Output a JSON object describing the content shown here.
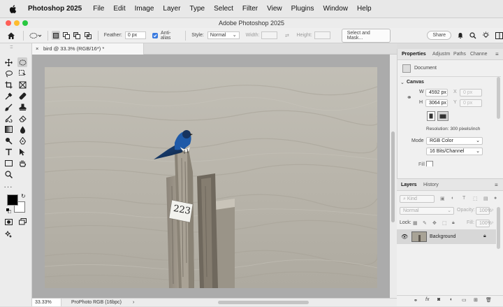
{
  "menubar": {
    "app": "Photoshop 2025",
    "items": [
      "File",
      "Edit",
      "Image",
      "Layer",
      "Type",
      "Select",
      "Filter",
      "View",
      "Plugins",
      "Window",
      "Help"
    ]
  },
  "window": {
    "title": "Adobe Photoshop 2025"
  },
  "options": {
    "feather_label": "Feather:",
    "feather_value": "0 px",
    "antialias_label": "Anti-alias",
    "style_label": "Style:",
    "style_value": "Normal",
    "width_label": "Width:",
    "height_label": "Height:",
    "select_mask": "Select and Mask...",
    "share": "Share"
  },
  "document": {
    "tab_title": "bird @ 33.3% (RGB/16*) *",
    "zoom": "33.33%",
    "profile": "ProPhoto RGB (16bpc)",
    "sign_text": "223"
  },
  "properties": {
    "tabs": [
      "Properties",
      "Adjustm",
      "Paths",
      "Channe"
    ],
    "doc_label": "Document",
    "section": "Canvas",
    "w_label": "W",
    "w_value": "4592 px",
    "h_label": "H",
    "h_value": "3064 px",
    "x_label": "X",
    "x_value": "0 px",
    "y_label": "Y",
    "y_value": "0 px",
    "resolution": "Resolution: 300 pixels/inch",
    "mode_label": "Mode",
    "mode_value": "RGB Color",
    "bits_value": "16 Bits/Channel",
    "fill_label": "Fill"
  },
  "layers": {
    "tabs": [
      "Layers",
      "History"
    ],
    "kind": "Kind",
    "blend": "Normal",
    "opacity_label": "Opacity:",
    "opacity_value": "100%",
    "lock_label": "Lock:",
    "fill_label": "Fill:",
    "fill_value": "100%",
    "items": [
      {
        "name": "Background"
      }
    ]
  },
  "colors": {
    "accent": "#2b6fe0",
    "foreground": "#000000",
    "background": "#ffffff"
  }
}
